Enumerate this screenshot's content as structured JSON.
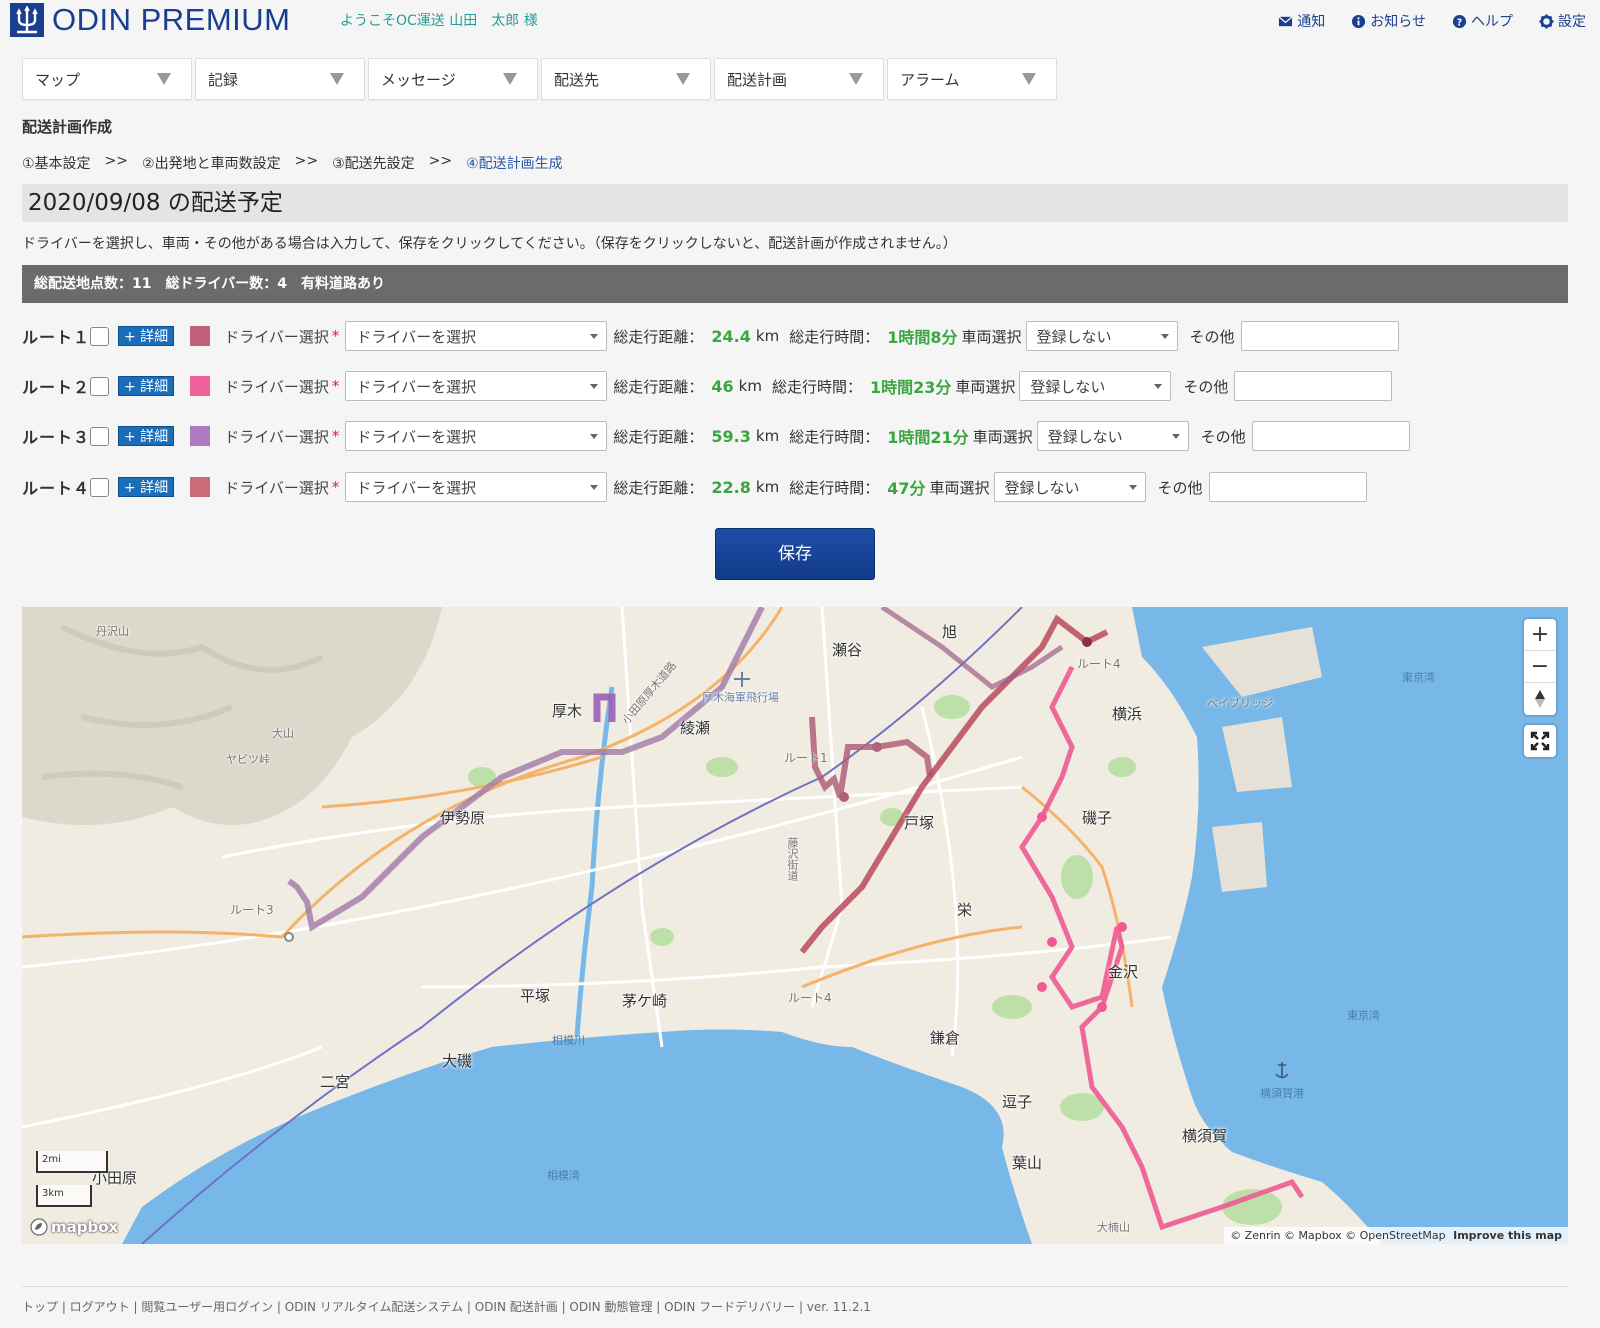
{
  "header": {
    "logo_text": "ODIN PREMIUM",
    "welcome": "ようこそOC運送 山田　太郎 様",
    "links": [
      {
        "label": "通知",
        "icon": "mail-icon"
      },
      {
        "label": "お知らせ",
        "icon": "info-icon"
      },
      {
        "label": "ヘルプ",
        "icon": "help-icon"
      },
      {
        "label": "設定",
        "icon": "gear-icon"
      }
    ]
  },
  "nav": [
    "マップ",
    "記録",
    "メッセージ",
    "配送先",
    "配送計画",
    "アラーム"
  ],
  "page_title": "配送計画作成",
  "steps": {
    "s1": "①基本設定",
    "s2": "②出発地と車両数設定",
    "s3": "③配送先設定",
    "s4": "④配送計画生成",
    "sep": ">>"
  },
  "date_heading": "2020/09/08 の配送予定",
  "instruction": "ドライバーを選択し、車両・その他がある場合は入力して、保存をクリックしてください。（保存をクリックしないと、配送計画が作成されません。）",
  "summary": "総配送地点数：11　総ドライバー数：4　有料道路あり",
  "labels": {
    "detail": "+ 詳細",
    "driver_select": "ドライバー選択",
    "required": "*",
    "driver_placeholder": "ドライバーを選択",
    "distance": "総走行距離：",
    "km": "km",
    "time": "総走行時間：",
    "vehicle": "車両選択",
    "vehicle_default": "登録しない",
    "other": "その他"
  },
  "routes": [
    {
      "name": "ルート１",
      "color": "#c0607a",
      "distance": "24.4",
      "time": "1時間8分"
    },
    {
      "name": "ルート２",
      "color": "#f0609a",
      "distance": "46",
      "time": "1時間23分"
    },
    {
      "name": "ルート３",
      "color": "#b07ac0",
      "distance": "59.3",
      "time": "1時間21分"
    },
    {
      "name": "ルート４",
      "color": "#cc6a78",
      "distance": "22.8",
      "time": "47分"
    }
  ],
  "save_label": "保存",
  "map": {
    "places": [
      "丹沢山",
      "大山",
      "ヤビツ峠",
      "厚木",
      "綾瀬",
      "瀬谷",
      "旭",
      "横浜",
      "伊勢原",
      "磯子",
      "戸塚",
      "栄",
      "金沢",
      "平塚",
      "茅ケ崎",
      "鎌倉",
      "大磯",
      "二宮",
      "逗子",
      "葉山",
      "横須賀",
      "小田原",
      "大楠山",
      "厚木海軍飛行場",
      "藤沢街道",
      "相模川",
      "東京湾",
      "相模湾",
      "横須賀港",
      "ベイブリッジ",
      "小田原厚木道路"
    ],
    "route_labels": [
      "ルート1",
      "ルート3",
      "ルート4",
      "ルート4"
    ],
    "scale_mi": "2mi",
    "scale_km": "3km",
    "logo": "mapbox",
    "attribution": "© Zenrin © Mapbox © OpenStreetMap",
    "improve": "Improve this map",
    "zoom_in": "+",
    "zoom_out": "−"
  },
  "footer": "トップ | ログアウト | 閲覧ユーザー用ログイン | ODIN リアルタイム配送システム | ODIN 配送計画 | ODIN 動態管理 | ODIN フードデリバリー | ver. 11.2.1"
}
